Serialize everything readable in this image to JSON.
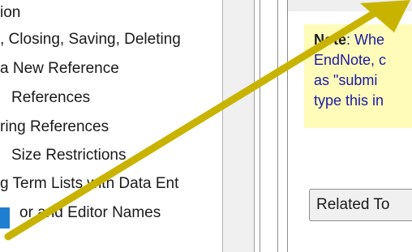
{
  "toc": {
    "items": [
      {
        "label": "ion"
      },
      {
        "label": ", Closing, Saving, Deleting"
      },
      {
        "label": "a New Reference"
      },
      {
        "label": "References"
      },
      {
        "label": "ring References"
      },
      {
        "label": "Size Restrictions"
      },
      {
        "label": "g Term Lists with Data Ent"
      },
      {
        "label": "or and Editor Names"
      }
    ]
  },
  "note": {
    "bold_label": "Note",
    "line1_rest": ": Whe",
    "line2": "EndNote, c",
    "line3": "as \"submi",
    "line4": "type this in"
  },
  "related_button_label": "Related To",
  "colors": {
    "arrow": "#c8b400",
    "note_bg": "#fffbb8",
    "link_text": "#1a1aa6",
    "selection": "#1e7fd0"
  }
}
